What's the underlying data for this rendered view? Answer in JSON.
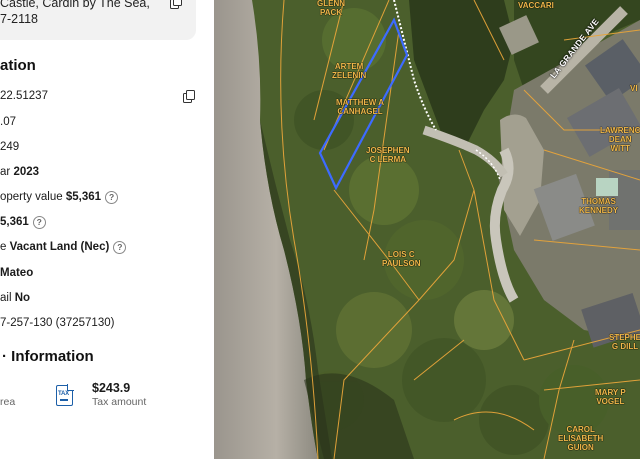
{
  "address": {
    "line1": "Castle, Cardin by The Sea,",
    "line2": "7-2118"
  },
  "location": {
    "title": "ation",
    "rows": {
      "latitude": "22.51237",
      "acres": ".07",
      "sqft": "249",
      "year_label": "ar",
      "year_value": "2023",
      "property_value_label": "operty value",
      "property_value": "$5,361",
      "assessed_value": "5,361",
      "land_use_label": "e",
      "land_use_value": "Vacant Land (Nec)",
      "county": "Mateo",
      "mail_label": "ail",
      "mail_value": "No",
      "apn": "7-257-130 (37257130)"
    }
  },
  "tax_info": {
    "title": "Information",
    "area_label": "rea",
    "icon_label": "TAX",
    "amount": "$243.9",
    "amount_label": "Tax amount"
  },
  "map": {
    "street": "LA GRANDE AVE",
    "owners": {
      "glenn_pack": [
        "GLENN",
        "PACK"
      ],
      "vaccari": [
        "VACCARI"
      ],
      "artem_zelenin": [
        "ARTEM",
        "ZELENIN"
      ],
      "matthew_canhagel": [
        "MATTHEW A",
        "CANHAGEL"
      ],
      "josephen_lerma": [
        "JOSEPHEN",
        "C LERMA"
      ],
      "lawrence_dean_witt": [
        "LAWRENC",
        "DEAN",
        "WITT"
      ],
      "thomas_kennedy": [
        "THOMAS",
        "KENNEDY"
      ],
      "lois_paulson": [
        "LOIS C",
        "PAULSON"
      ],
      "stephen_dill": [
        "STEPHE",
        "G DILL"
      ],
      "mary_vogel": [
        "MARY P",
        "VOGEL"
      ],
      "carol_guion": [
        "CAROL",
        "ELISABETH",
        "GUION"
      ],
      "vi": [
        "VI"
      ]
    },
    "colors": {
      "parcel_highlight": "#3d6bff",
      "parcel_lines": "#e8a53a",
      "owner_labels": "#f0b84a"
    }
  }
}
